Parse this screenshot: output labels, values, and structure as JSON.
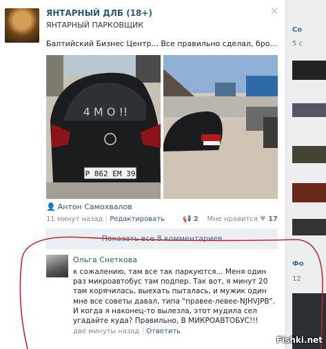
{
  "post": {
    "group_name": "ЯНТАРНЫЙ ДЛБ (18+)",
    "group_subtitle": "ЯНТАРНЫЙ ПАРКОВЩИК",
    "text": "Балтийский Бизнес Центр... Все правильно сделал, бро...",
    "author": "Антон Самохвалов",
    "time": "11 минут назад",
    "edit_label": "Редактировать",
    "share_count": "2",
    "like_label": "Мне нравится",
    "like_count": "17",
    "show_all": "Показать все 8 комментариев",
    "plate1": "Р 862 ЕМ 39",
    "dust_text": "4 M O !!"
  },
  "comment": {
    "author": "Ольга Снеткова",
    "text": "к сожалению, там все так паркуются... Меня один раз микроавтобус там подпер. Так вот, я минут 20 там корячилась, выехать пыталась, и мужик один мне все советы давал, типа \"правее-левее-NJHVJPB\". И когда я наконец-то вылезла, этот мудила сел угадайте куда? Правильно, В МИКРОАВТОБУС!!!",
    "time": "две минуты назад",
    "reply_label": "Ответить"
  },
  "right": {
    "item1": "Со",
    "item2": "5 с",
    "item3": "Фо",
    "item4": "12"
  },
  "watermark": "Fishki.net",
  "colors": {
    "link": "#2b587a",
    "annotation": "#c0272d"
  }
}
